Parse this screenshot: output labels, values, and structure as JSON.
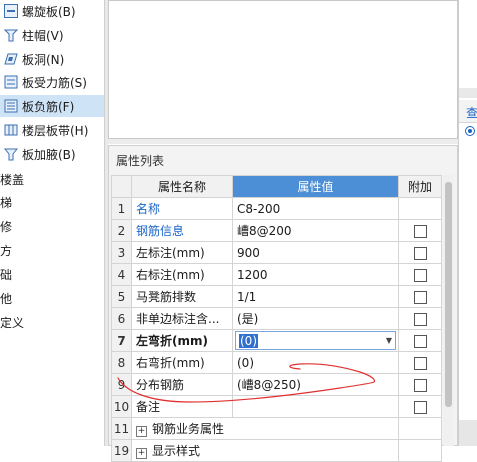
{
  "tree": {
    "items": [
      {
        "label": "螺旋板(B)",
        "icon": "spiral-slab-icon"
      },
      {
        "label": "柱帽(V)",
        "icon": "column-cap-icon"
      },
      {
        "label": "板洞(N)",
        "icon": "slab-hole-icon"
      },
      {
        "label": "板受力筋(S)",
        "icon": "slab-main-rebar-icon"
      },
      {
        "label": "板负筋(F)",
        "icon": "slab-negative-rebar-icon",
        "selected": true
      },
      {
        "label": "楼层板带(H)",
        "icon": "floor-slab-strip-icon"
      },
      {
        "label": "板加腋(B)",
        "icon": "slab-haunch-icon"
      }
    ],
    "truncated": [
      "楼盖",
      "梯",
      "修",
      "方",
      "础",
      "他",
      "定义"
    ]
  },
  "property_panel": {
    "title": "属性列表",
    "headers": {
      "name": "属性名称",
      "value": "属性值",
      "add": "附加"
    },
    "rows": [
      {
        "num": "1",
        "name": "名称",
        "value": "C8-200",
        "blue": true,
        "checkbox": false
      },
      {
        "num": "2",
        "name": "钢筋信息",
        "value": "嶆8@200",
        "blue": true,
        "checkbox": true
      },
      {
        "num": "3",
        "name": "左标注(mm)",
        "value": "900",
        "checkbox": true
      },
      {
        "num": "4",
        "name": "右标注(mm)",
        "value": "1200",
        "checkbox": true
      },
      {
        "num": "5",
        "name": "马凳筋排数",
        "value": "1/1",
        "checkbox": true
      },
      {
        "num": "6",
        "name": "非单边标注含...",
        "value": "(是)",
        "checkbox": true
      },
      {
        "num": "7",
        "name": "左弯折(mm)",
        "value": "(0)",
        "checkbox": true,
        "active": true
      },
      {
        "num": "8",
        "name": "右弯折(mm)",
        "value": "(0)",
        "checkbox": true
      },
      {
        "num": "9",
        "name": "分布钢筋",
        "value": "(嶆8@250)",
        "checkbox": true
      },
      {
        "num": "10",
        "name": "备注",
        "value": "",
        "checkbox": true
      },
      {
        "num": "11",
        "name": "钢筋业务属性",
        "value": "",
        "group": true
      },
      {
        "num": "19",
        "name": "显示样式",
        "value": "",
        "group": true
      }
    ]
  },
  "right_strip": {
    "tab_label": "查",
    "radio_selected": true
  },
  "colors": {
    "header_blue": "#4d8fd6",
    "link_blue": "#1a64c8",
    "selected_row": "#cfe3f7",
    "annotation_red": "#e03030"
  }
}
